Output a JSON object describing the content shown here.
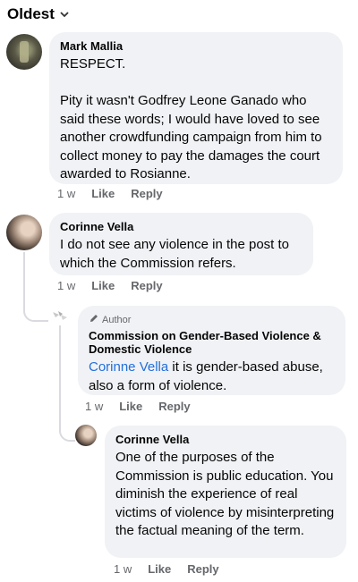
{
  "sort": {
    "label": "Oldest"
  },
  "comments": [
    {
      "author": "Mark Mallia",
      "text": "RESPECT.\n\nPity it wasn't Godfrey Leone Ganado who said these words; I would have loved to see another crowdfunding campaign from him to collect money to pay the damages the court awarded to Rosianne.",
      "time": "1 w",
      "like": "Like",
      "reply": "Reply"
    },
    {
      "author": "Corinne Vella",
      "text": "I do not see any violence in the post to which the Commission refers.",
      "time": "1 w",
      "like": "Like",
      "reply": "Reply"
    },
    {
      "badge": "Author",
      "author": "Commission on Gender-Based Violence & Domestic Violence",
      "mention": "Corinne Vella",
      "text": " it is gender-based abuse, also a form of violence.",
      "time": "1 w",
      "like": "Like",
      "reply": "Reply"
    },
    {
      "author": "Corinne Vella",
      "text": "One of the purposes of the Commission is public education. You diminish the experience of real victims of violence by misinterpreting the factual meaning of the term.",
      "time": "1 w",
      "like": "Like",
      "reply": "Reply"
    }
  ]
}
